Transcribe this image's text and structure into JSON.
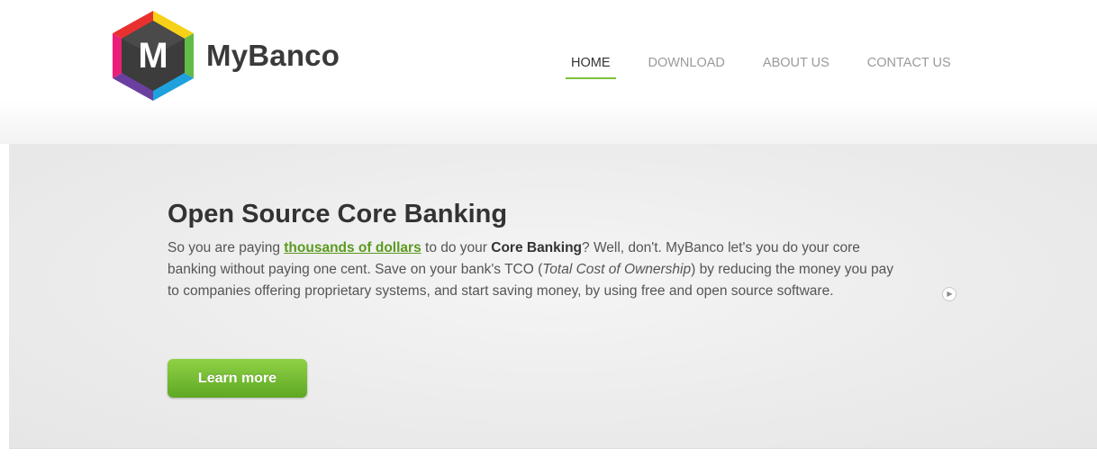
{
  "brand": {
    "logo_letter": "M",
    "name": "MyBanco"
  },
  "nav": {
    "items": [
      {
        "label": "HOME",
        "active": true
      },
      {
        "label": "DOWNLOAD",
        "active": false
      },
      {
        "label": "ABOUT US",
        "active": false
      },
      {
        "label": "CONTACT US",
        "active": false
      }
    ]
  },
  "hero": {
    "title": "Open Source Core Banking",
    "text": {
      "p1": "So you are paying ",
      "link": "thousands of dollars",
      "p2": " to do your ",
      "bold": "Core Banking",
      "p3": "? Well, don't. MyBanco let's you do your core banking without paying one cent. Save on your bank's TCO (",
      "italic": "Total Cost of Ownership",
      "p4": ") by reducing the money you pay to companies offering proprietary systems, and start saving money, by using free and open source software."
    },
    "button_label": "Learn more",
    "next_icon": "next-slide-icon"
  },
  "colors": {
    "accent": "#7dc03a",
    "link": "#5a9a1e",
    "logo_ring": [
      "#e8312f",
      "#f7d117",
      "#62bb46",
      "#1ea1dc",
      "#6b3fa0",
      "#ec1e79"
    ],
    "logo_core": "#3c3c3c"
  }
}
